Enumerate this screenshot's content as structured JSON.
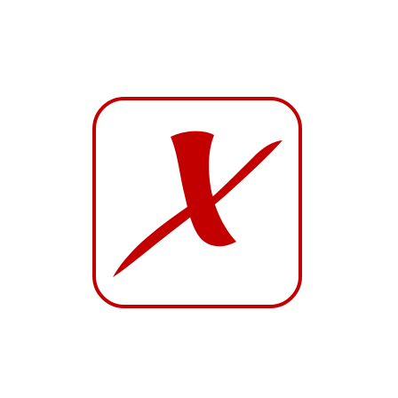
{
  "icon": {
    "name": "checkbox-x-icon",
    "mark": "x-mark",
    "checked": true
  },
  "colors": {
    "background": "#ffffff",
    "accent": "#c20000"
  }
}
